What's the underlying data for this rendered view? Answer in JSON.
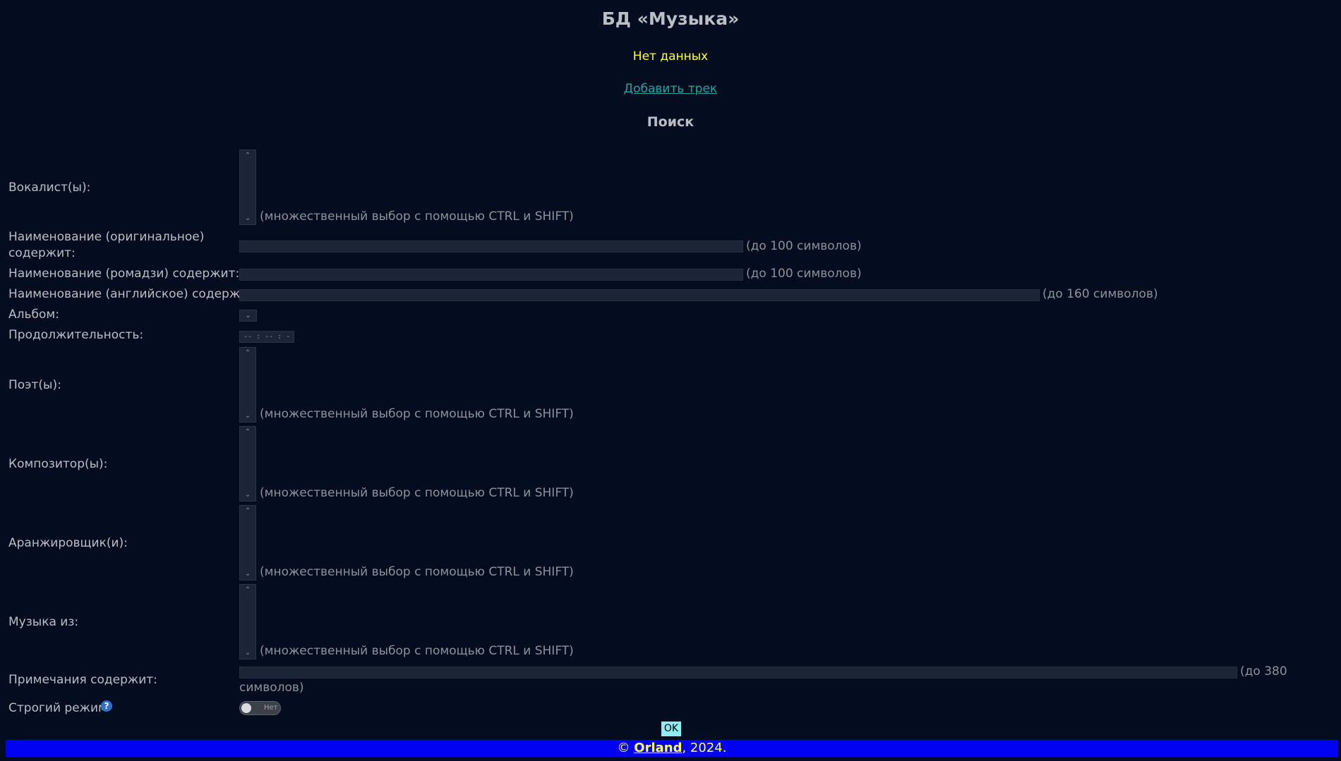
{
  "header": {
    "title": "БД «Музыка»",
    "no_data": "Нет данных",
    "add_link": "Добавить трек",
    "search_heading": "Поиск"
  },
  "form": {
    "vocalists_label": "Вокалист(ы):",
    "multi_hint": "(множественный выбор с помощью CTRL и SHIFT)",
    "name_orig_label_1": "Наименование (оригинальное)",
    "name_orig_label_2": "содержит:",
    "name_orig_hint": "(до 100 символов)",
    "name_romaji_label": "Наименование (ромадзи) содержит:",
    "name_romaji_hint": "(до 100 символов)",
    "name_en_label": "Наименование (английское) содержит:",
    "name_en_hint": "(до 160 символов)",
    "album_label": "Альбом:",
    "duration_label": "Продолжительность:",
    "duration_placeholder": "-- : -- : --",
    "poets_label": "Поэт(ы):",
    "composers_label": "Композитор(ы):",
    "arrangers_label": "Аранжировщик(и):",
    "music_from_label": "Музыка из:",
    "notes_label": "Примечания содержит:",
    "notes_hint_1": "(до 380",
    "notes_hint_2": "символов)",
    "strict_label": "Строгий режим",
    "strict_toggle_text": "Нет",
    "ok_label": "OK"
  },
  "footer": {
    "prefix": "© ",
    "author": "Orland",
    "suffix": ", 2024."
  },
  "colors": {
    "background": "#040d1f",
    "nodata": "#ffff33",
    "link": "#1aa5a5",
    "footer_bg": "#0202f2",
    "footer_text": "#ffff55",
    "ok_button": "#8fecf2"
  }
}
